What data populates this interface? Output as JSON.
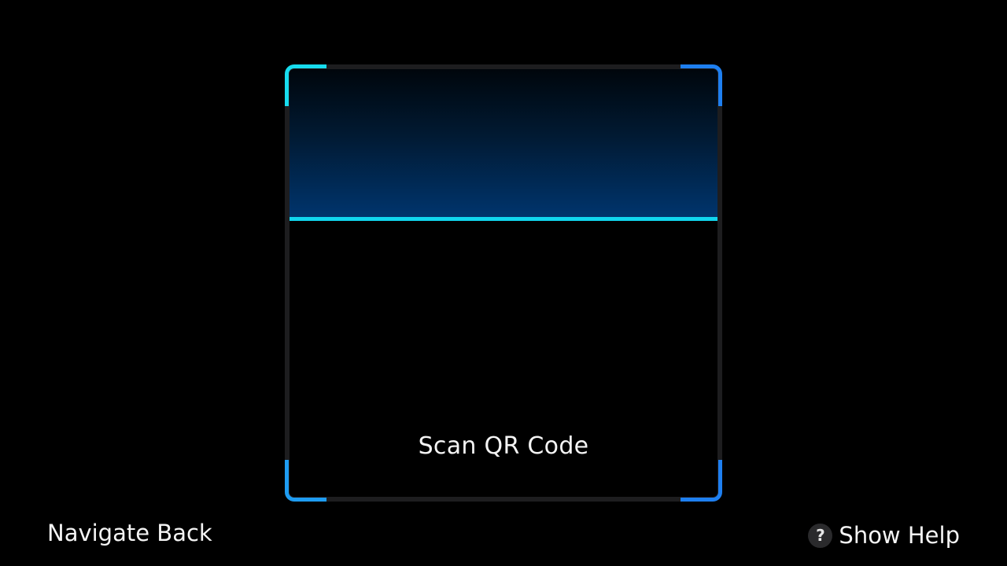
{
  "scanner": {
    "label": "Scan QR Code",
    "colors": {
      "scan_line": "#11d6ee",
      "corner_top_left": "#17dcee",
      "corner_top_right": "#1e7ff0",
      "corner_bottom_left": "#1e9cf2",
      "corner_bottom_right": "#1e7ff0",
      "frame_border": "#1d1d1f"
    }
  },
  "footer": {
    "navigate_back_label": "Navigate Back",
    "show_help_label": "Show Help",
    "help_icon_glyph": "?",
    "help_icon_name": "help-icon"
  }
}
